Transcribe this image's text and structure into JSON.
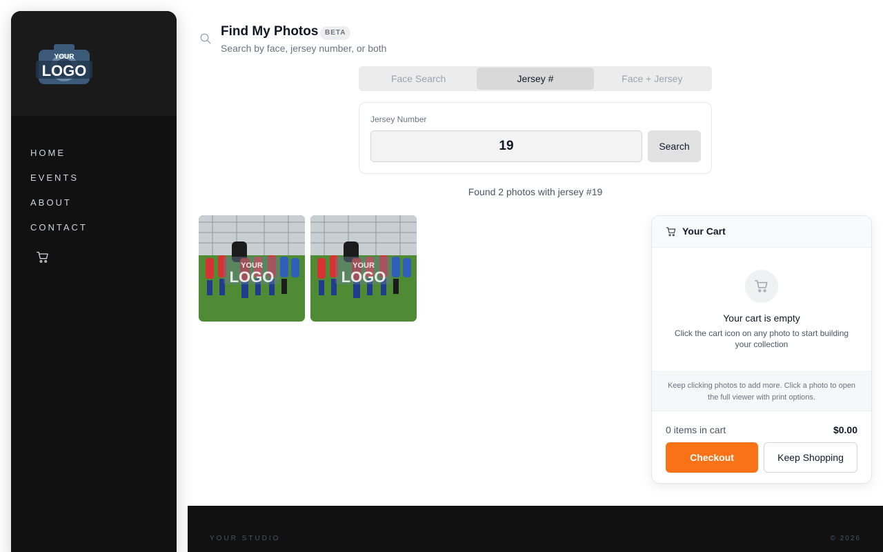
{
  "sidebar": {
    "logo_text_top": "YOUR",
    "logo_text_main": "LOGO",
    "nav": [
      {
        "label": "HOME"
      },
      {
        "label": "EVENTS"
      },
      {
        "label": "ABOUT"
      },
      {
        "label": "CONTACT"
      }
    ],
    "cart_icon": "cart-icon"
  },
  "header": {
    "title": "Find My Photos",
    "badge": "BETA",
    "subtitle": "Search by face, jersey number, or both",
    "icon": "search-icon"
  },
  "tabs": [
    {
      "label": "Face Search",
      "active": false
    },
    {
      "label": "Jersey #",
      "active": true
    },
    {
      "label": "Face + Jersey",
      "active": false
    }
  ],
  "search": {
    "label": "Jersey Number",
    "value": "19",
    "button": "Search"
  },
  "results": {
    "text": "Found 2 photos with jersey #19",
    "photos": [
      {
        "watermark_top": "YOUR",
        "watermark_main": "LOGO"
      },
      {
        "watermark_top": "YOUR",
        "watermark_main": "LOGO"
      }
    ]
  },
  "cart": {
    "title": "Your Cart",
    "empty_title": "Your cart is empty",
    "empty_desc": "Click the cart icon on any photo to start building your collection",
    "hint": "Keep clicking photos to add more. Click a photo to open the full viewer with print options.",
    "count": "0 items in cart",
    "total": "$0.00",
    "checkout": "Checkout",
    "keep_shopping": "Keep Shopping",
    "accent": "#f97316"
  },
  "footer": {
    "left": "YOUR STUDIO",
    "right": "© 2026"
  }
}
